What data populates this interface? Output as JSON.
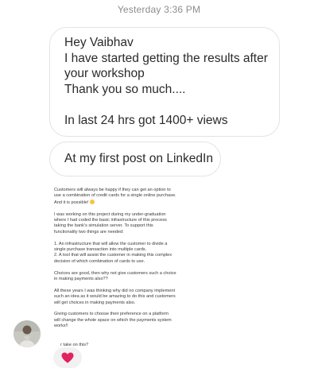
{
  "timestamp": "Yesterday 3:36 PM",
  "messages": {
    "first": {
      "lines": [
        "Hey Vaibhav",
        "I have started getting the results after",
        "your workshop",
        "Thank you so much....",
        "In last 24 hrs got 1400+ views"
      ]
    },
    "second": {
      "text": "At my first post on LinkedIn"
    }
  },
  "post_image": {
    "paragraphs": [
      [
        "Customers will always be happy if they can get an option to",
        "use a combination of credit cards for a single online purchase.",
        "And it is possible!"
      ],
      [
        "I was working on this project during my under-graduation",
        "where I had coded the basic infrastructure of this process",
        "taking the bank's simulation server. To support this",
        "functionality two things are needed:"
      ],
      [
        "1.  An infrastructure that will allow the customer to divide a",
        "single purchase transaction into multiple cards.",
        "2.  A tool that will assist the customer in making this complex",
        "decision of which combination of cards to use."
      ],
      [
        "Choices are good, then why not give customers such a choice",
        "in making payments also??"
      ],
      [
        "All these years I was thinking why did no company implement",
        "such an idea as it would be amazing to do this and customers",
        "will get choices in making payments also."
      ],
      [
        "Giving customers to choose their preference on a platform",
        "will change the whole space on which the payments system",
        "works!!"
      ]
    ],
    "last_line": "r take on this?"
  },
  "reaction": {
    "icon": "heart-icon",
    "color": "#e0245e"
  },
  "colors": {
    "bubble_border": "#e3e3e3",
    "timestamp": "#8c8c8c"
  }
}
